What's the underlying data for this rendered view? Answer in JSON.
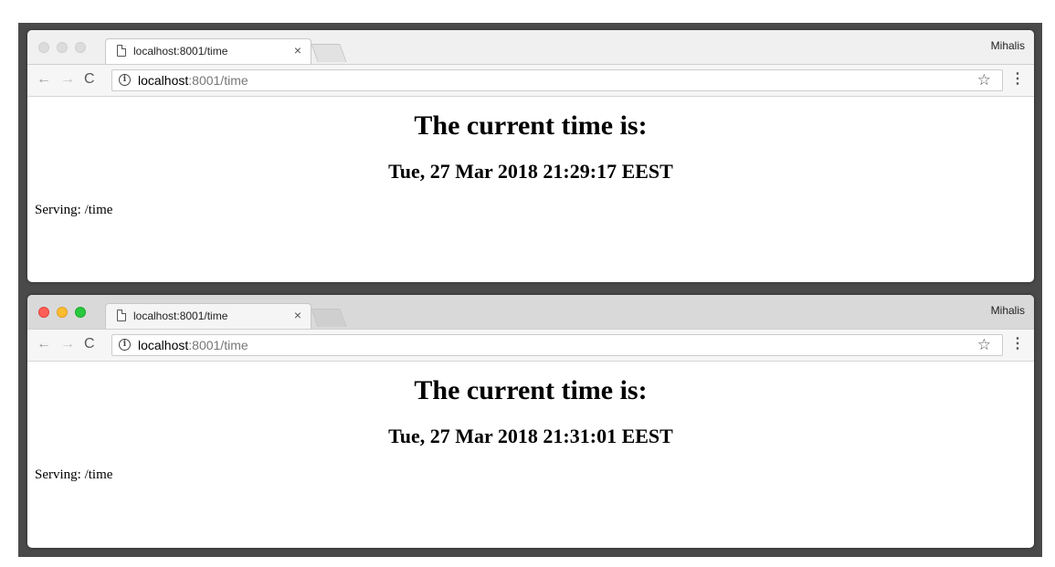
{
  "windows": [
    {
      "tab_title": "localhost:8001/time",
      "tab_close": "×",
      "user_name": "Mihalis",
      "url_host": "localhost",
      "url_rest": ":8001/time",
      "heading": "The current time is:",
      "time": "Tue, 27 Mar 2018 21:29:17 EEST",
      "serving": "Serving: /time",
      "focused": false
    },
    {
      "tab_title": "localhost:8001/time",
      "tab_close": "×",
      "user_name": "Mihalis",
      "url_host": "localhost",
      "url_rest": ":8001/time",
      "heading": "The current time is:",
      "time": "Tue, 27 Mar 2018 21:31:01 EEST",
      "serving": "Serving: /time",
      "focused": true
    }
  ],
  "icons": {
    "back": "←",
    "forward": "→",
    "reload": "C",
    "info": "i",
    "star": "☆",
    "menu": "⋮"
  },
  "colors": {
    "close_red": "#fc5f57",
    "minimize_yellow": "#fdbc2e",
    "zoom_green": "#28c840",
    "inactive_dot": "#dcdcdc"
  }
}
